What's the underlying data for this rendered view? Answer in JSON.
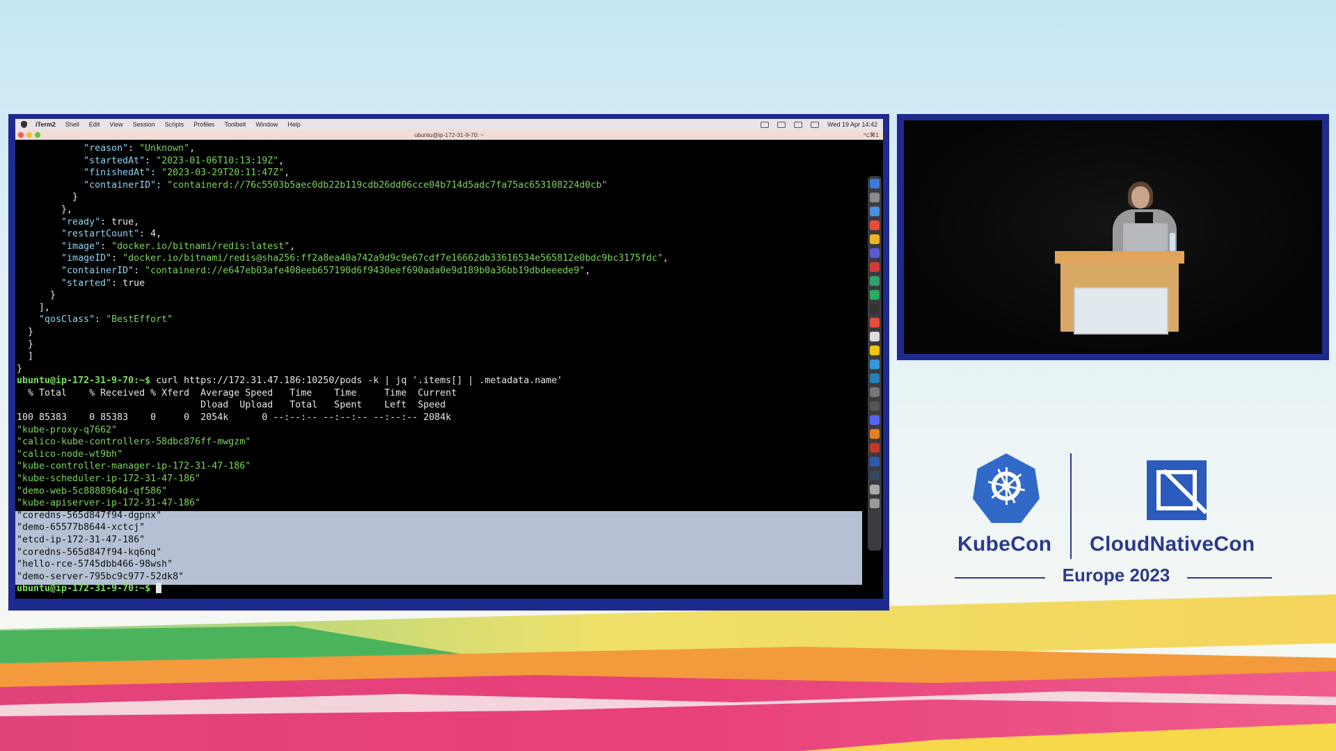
{
  "menubar": {
    "app": "iTerm2",
    "items": [
      "Shell",
      "Edit",
      "View",
      "Session",
      "Scripts",
      "Profiles",
      "Toolbelt",
      "Window",
      "Help"
    ],
    "clock": "Wed 19 Apr  14:42"
  },
  "window": {
    "title": "ubuntu@ip-172-31-9-70: ~",
    "shortcut": "⌥⌘1"
  },
  "terminal": {
    "prompt": "ubuntu@ip-172-31-9-70",
    "prompt_suffix": ":~$",
    "command": " curl https://172.31.47.186:10250/pods -k | jq '.items[] | .metadata.name'",
    "json_output": [
      [
        "            ",
        "\"reason\"",
        ": ",
        "\"Unknown\"",
        ","
      ],
      [
        "            ",
        "\"startedAt\"",
        ": ",
        "\"2023-01-06T10:13:19Z\"",
        ","
      ],
      [
        "            ",
        "\"finishedAt\"",
        ": ",
        "\"2023-03-29T20:11:47Z\"",
        ","
      ],
      [
        "            ",
        "\"containerID\"",
        ": ",
        "\"containerd://76c5503b5aec0db22b119cdb26dd06cce04b714d5adc7fa75ac653108224d0cb\"",
        ""
      ],
      [
        "          }",
        "",
        "",
        "",
        ""
      ],
      [
        "        },",
        "",
        "",
        "",
        ""
      ],
      [
        "        ",
        "\"ready\"",
        ": true,",
        "",
        ""
      ],
      [
        "        ",
        "\"restartCount\"",
        ": 4,",
        "",
        ""
      ],
      [
        "        ",
        "\"image\"",
        ": ",
        "\"docker.io/bitnami/redis:latest\"",
        ","
      ],
      [
        "        ",
        "\"imageID\"",
        ": ",
        "\"docker.io/bitnami/redis@sha256:ff2a8ea40a742a9d9c9e67cdf7e16662db33616534e565812e0bdc9bc3175fdc\"",
        ","
      ],
      [
        "        ",
        "\"containerID\"",
        ": ",
        "\"containerd://e647eb03afe408eeb657190d6f9430eef690ada0e9d189b0a36bb19dbdeeede9\"",
        ","
      ],
      [
        "        ",
        "\"started\"",
        ": true",
        "",
        ""
      ],
      [
        "      }",
        "",
        "",
        "",
        ""
      ],
      [
        "    ],",
        "",
        "",
        "",
        ""
      ],
      [
        "    ",
        "\"qosClass\"",
        ": ",
        "\"BestEffort\"",
        ""
      ],
      [
        "  }",
        "",
        "",
        "",
        ""
      ],
      [
        "  }",
        "",
        "",
        "",
        ""
      ],
      [
        "  ]",
        "",
        "",
        "",
        ""
      ],
      [
        "}",
        "",
        "",
        "",
        ""
      ]
    ],
    "curl_header1": "  % Total    % Received % Xferd  Average Speed   Time    Time     Time  Current",
    "curl_header2": "                                 Dload  Upload   Total   Spent    Left  Speed",
    "curl_stats": "100 85383    0 85383    0     0  2054k      0 --:--:-- --:--:-- --:--:-- 2084k",
    "pod_names": [
      "\"kube-proxy-q7662\"",
      "\"calico-kube-controllers-58dbc876ff-mwgzm\"",
      "\"calico-node-wt9bh\"",
      "\"kube-controller-manager-ip-172-31-47-186\"",
      "\"kube-scheduler-ip-172-31-47-186\"",
      "\"demo-web-5c8888964d-qf586\"",
      "\"kube-apiserver-ip-172-31-47-186\""
    ],
    "selected_pod_names": [
      "\"coredns-565d847f94-dgpnx\"",
      "\"demo-65577b8644-xctcj\"",
      "\"etcd-ip-172-31-47-186\"",
      "\"coredns-565d847f94-kq6nq\"",
      "\"hello-rce-5745dbb466-98wsh\"",
      "\"demo-server-795bc9c977-52dk8\""
    ]
  },
  "branding": {
    "kubecon": "KubeCon",
    "cloudnativecon": "CloudNativeCon",
    "event": "Europe 2023",
    "brand_color": "#2b3a8c"
  }
}
